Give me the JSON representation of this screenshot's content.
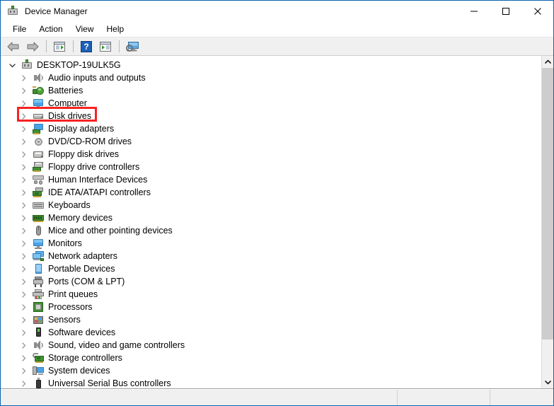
{
  "window": {
    "title": "Device Manager",
    "title_icon": "computer-device-icon",
    "border_color": "#0a64ad",
    "buttons": {
      "minimize": "Minimize",
      "maximize": "Maximize",
      "close": "Close"
    }
  },
  "menubar": {
    "items": [
      {
        "label": "File"
      },
      {
        "label": "Action"
      },
      {
        "label": "View"
      },
      {
        "label": "Help"
      }
    ]
  },
  "toolbar": {
    "buttons": [
      {
        "name": "back-arrow-icon",
        "type": "icon"
      },
      {
        "name": "forward-arrow-icon",
        "type": "icon"
      },
      {
        "name": "separator",
        "type": "separator"
      },
      {
        "name": "properties-icon",
        "type": "icon"
      },
      {
        "name": "separator",
        "type": "separator"
      },
      {
        "name": "help-icon",
        "type": "icon"
      },
      {
        "name": "update-driver-icon",
        "type": "icon"
      },
      {
        "name": "separator",
        "type": "separator"
      },
      {
        "name": "scan-hardware-changes-icon",
        "type": "icon"
      }
    ]
  },
  "tree": {
    "root": {
      "label": "DESKTOP-19ULK5G",
      "icon": "computer-device-icon",
      "expanded": true
    },
    "nodes": [
      {
        "label": "Audio inputs and outputs",
        "icon": "speaker-icon"
      },
      {
        "label": "Batteries",
        "icon": "battery-icon"
      },
      {
        "label": "Computer",
        "icon": "monitor-icon"
      },
      {
        "label": "Disk drives",
        "icon": "disk-drive-icon",
        "highlighted": true
      },
      {
        "label": "Display adapters",
        "icon": "display-adapter-icon"
      },
      {
        "label": "DVD/CD-ROM drives",
        "icon": "dvd-disc-icon"
      },
      {
        "label": "Floppy disk drives",
        "icon": "floppy-disk-icon"
      },
      {
        "label": "Floppy drive controllers",
        "icon": "floppy-controller-icon"
      },
      {
        "label": "Human Interface Devices",
        "icon": "hid-icon"
      },
      {
        "label": "IDE ATA/ATAPI controllers",
        "icon": "ide-controller-icon"
      },
      {
        "label": "Keyboards",
        "icon": "keyboard-icon"
      },
      {
        "label": "Memory devices",
        "icon": "memory-icon"
      },
      {
        "label": "Mice and other pointing devices",
        "icon": "mouse-icon"
      },
      {
        "label": "Monitors",
        "icon": "monitor-icon"
      },
      {
        "label": "Network adapters",
        "icon": "network-adapter-icon"
      },
      {
        "label": "Portable Devices",
        "icon": "portable-device-icon"
      },
      {
        "label": "Ports (COM & LPT)",
        "icon": "port-connector-icon"
      },
      {
        "label": "Print queues",
        "icon": "printer-icon"
      },
      {
        "label": "Processors",
        "icon": "processor-icon"
      },
      {
        "label": "Sensors",
        "icon": "sensor-icon"
      },
      {
        "label": "Software devices",
        "icon": "software-device-icon"
      },
      {
        "label": "Sound, video and game controllers",
        "icon": "speaker-icon"
      },
      {
        "label": "Storage controllers",
        "icon": "storage-controller-icon"
      },
      {
        "label": "System devices",
        "icon": "system-device-icon"
      },
      {
        "label": "Universal Serial Bus controllers",
        "icon": "usb-icon"
      }
    ]
  },
  "highlight": {
    "target_label": "Disk drives",
    "color": "#f72222"
  },
  "scrollbar": {
    "up_arrow": "scroll-up",
    "down_arrow": "scroll-down",
    "thumb_position_percent": 0
  },
  "statusbar": {
    "panes": [
      {
        "text": ""
      },
      {
        "text": ""
      },
      {
        "text": ""
      }
    ]
  }
}
